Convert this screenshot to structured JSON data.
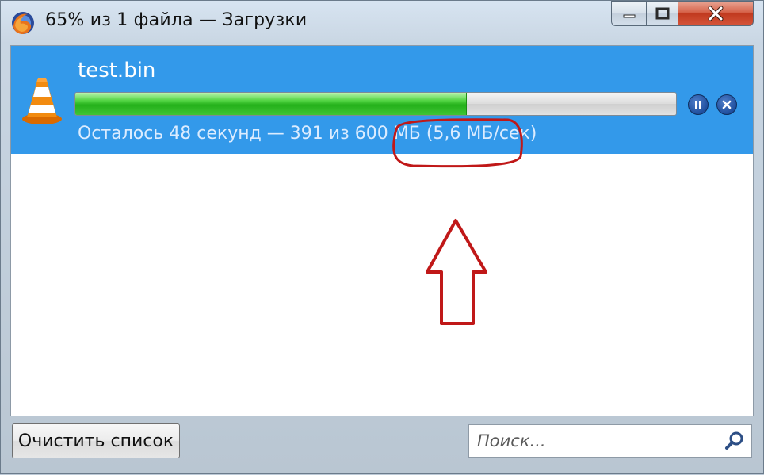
{
  "window": {
    "title": "65% из 1 файла — Загрузки",
    "controls": {
      "minimize": "minimize-icon",
      "maximize": "maximize-icon",
      "close": "close-icon"
    }
  },
  "download": {
    "filename": "test.bin",
    "progress": 0.65,
    "status": "Осталось 48 секунд — 391 из 600 МБ (5,6 МБ/сек)",
    "icon": "vlc-cone-icon"
  },
  "footer": {
    "clear_label": "Очистить список",
    "search_placeholder": "Поиск...",
    "search_value": ""
  },
  "colors": {
    "selection": "#3399ea",
    "progress_green": "#24b01a",
    "annotation_red": "#c01818"
  }
}
